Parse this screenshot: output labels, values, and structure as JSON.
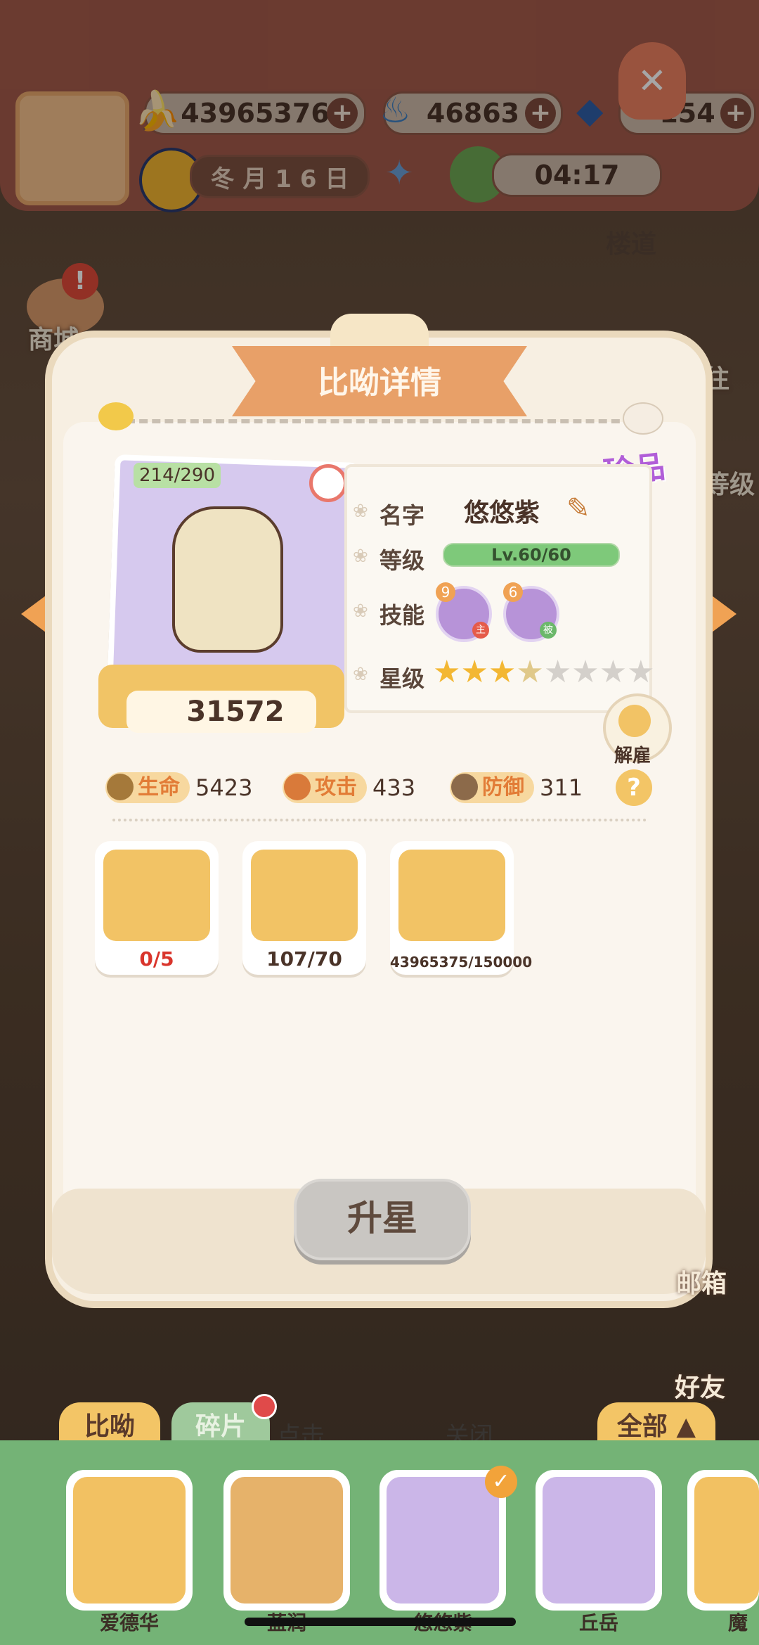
{
  "hud": {
    "bananas": "43965376",
    "flames": "46863",
    "fish": "154",
    "date": "冬 月 1 6 日",
    "timer": "04:17"
  },
  "side": {
    "shop": "商城",
    "corridor": "楼道",
    "level_partial": "等级",
    "live_partial": "往",
    "mail": "邮箱",
    "friends": "好友"
  },
  "panel": {
    "title": "比呦详情",
    "rarity": "珍品",
    "card": {
      "progress": "214/290",
      "power": "31572"
    },
    "info": {
      "name_label": "名字",
      "name_value": "悠悠紫",
      "level_label": "等级",
      "level_value": "Lv.60/60",
      "level_fill": 1.0,
      "skill_label": "技能",
      "skills": [
        {
          "level": "9",
          "tag": "主"
        },
        {
          "level": "6",
          "tag": "被"
        }
      ],
      "star_label": "星级",
      "stars_filled": 3,
      "stars_half": 1,
      "stars_total": 8
    },
    "dismiss": "解雇",
    "stats": {
      "hp_label": "生命",
      "hp": "5423",
      "atk_label": "攻击",
      "atk": "433",
      "def_label": "防御",
      "def": "311",
      "help": "?"
    },
    "materials": [
      {
        "icon": "statue-icon",
        "value": "0/5",
        "color": "#d9352c"
      },
      {
        "icon": "puzzle-shard-icon",
        "value": "107/70",
        "color": "#4a3328"
      },
      {
        "icon": "banana-icon",
        "value": "43965375/150000",
        "color": "#4a3328"
      }
    ],
    "upgrade_button": "升星"
  },
  "bottom": {
    "tab_active": "比呦",
    "tab_inactive": "碎片",
    "hint_partial": "点击",
    "hint_partial2": "关闭",
    "filter": "全部 ▲",
    "roster": [
      {
        "name": "爱德华",
        "bg": "#f2c162"
      },
      {
        "name": "蓝润",
        "bg": "#e6b26a"
      },
      {
        "name": "悠悠紫",
        "bg": "#cbb6e8"
      },
      {
        "name": "丘岳",
        "bg": "#cbb6e8"
      },
      {
        "name": "魔",
        "bg": "#f2c162"
      }
    ]
  }
}
